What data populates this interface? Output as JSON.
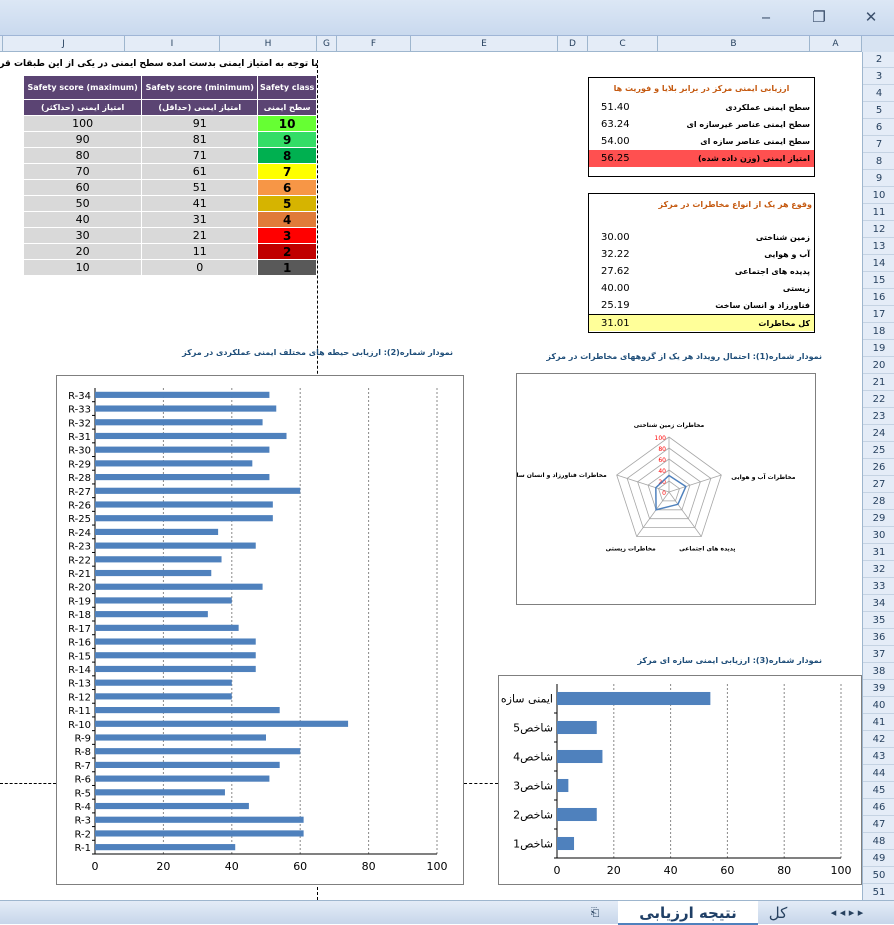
{
  "window": {
    "minimize": "‒",
    "restore": "❐",
    "close": "✕"
  },
  "columns": [
    "J",
    "I",
    "H",
    "G",
    "F",
    "E",
    "D",
    "C",
    "B",
    "A"
  ],
  "rows": [
    "2",
    "3",
    "4",
    "5",
    "6",
    "7",
    "8",
    "9",
    "10",
    "11",
    "12",
    "13",
    "14",
    "15",
    "16",
    "17",
    "18",
    "19",
    "20",
    "21",
    "22",
    "23",
    "24",
    "25",
    "26",
    "27",
    "28",
    "29",
    "30",
    "31",
    "32",
    "33",
    "34",
    "35",
    "36",
    "37",
    "38",
    "39",
    "40",
    "41",
    "42",
    "43",
    "44",
    "45",
    "46",
    "47",
    "48",
    "49",
    "50",
    "51"
  ],
  "top_text": "با توجه به امتیاز ایمنی بدست آمده سطح ایمنی در یکی از این طبقات قرار می گیرد",
  "safety_table": {
    "headers": [
      "Safety score (maximum)",
      "Safety score (minimum)",
      "Safety class"
    ],
    "subheaders": [
      "امتیاز ایمنی (حداکثر)",
      "امتیاز ایمنی (حداقل)",
      "سطح ایمنی"
    ],
    "rows": [
      {
        "max": "100",
        "min": "91",
        "cls": "10",
        "color": "#66ff33"
      },
      {
        "max": "90",
        "min": "81",
        "cls": "9",
        "color": "#33dd66"
      },
      {
        "max": "80",
        "min": "71",
        "cls": "8",
        "color": "#00b050"
      },
      {
        "max": "70",
        "min": "61",
        "cls": "7",
        "color": "#ffff00"
      },
      {
        "max": "60",
        "min": "51",
        "cls": "6",
        "color": "#f79646"
      },
      {
        "max": "50",
        "min": "41",
        "cls": "5",
        "color": "#d6b400"
      },
      {
        "max": "40",
        "min": "31",
        "cls": "4",
        "color": "#e07b39"
      },
      {
        "max": "30",
        "min": "21",
        "cls": "3",
        "color": "#ff0000"
      },
      {
        "max": "20",
        "min": "11",
        "cls": "2",
        "color": "#c00000"
      },
      {
        "max": "10",
        "min": "0",
        "cls": "1",
        "color": "#595959"
      }
    ]
  },
  "assessment": {
    "title": "ارزیابی ایمنی مرکز در برابر بلایا و فوریت ها",
    "rows": [
      {
        "label": "سطح ایمنی عملکردی",
        "value": "51.40"
      },
      {
        "label": "سطح ایمنی عناصر غیرسازه ای",
        "value": "63.24"
      },
      {
        "label": "سطح ایمنی عناصر سازه ای",
        "value": "54.00"
      }
    ],
    "total": {
      "label": "امتیاز ایمنی (وزن داده شده)",
      "value": "56.25"
    }
  },
  "hazards": {
    "title": "وقوع هر یک از انواع مخاطرات در مرکز",
    "rows": [
      {
        "label": "زمین شناختی",
        "value": "30.00"
      },
      {
        "label": "آب و هوایی",
        "value": "32.22"
      },
      {
        "label": "پدیده های اجتماعی",
        "value": "27.62"
      },
      {
        "label": "زیستی",
        "value": "40.00"
      },
      {
        "label": "فناورزاد و انسان ساخت",
        "value": "25.19"
      }
    ],
    "total": {
      "label": "کل مخاطرات",
      "value": "31.01"
    }
  },
  "captions": {
    "chart1": "نمودار شماره(1): احتمال رویداد هر یک از گروههای مخاطرات در مرکز",
    "chart2": "نمودار شماره(2): ارزیابی حیطه های مختلف ایمنی عملکردی در مرکز",
    "chart3": "نمودار شماره(3): ارزیابی ایمنی سازه ای مرکز"
  },
  "colors": {
    "bar": "#4f81bd",
    "radar_series": "#4f81bd",
    "radar_tick": "#ff0000",
    "caption": "#1f4e79"
  },
  "chart_data": [
    {
      "type": "bar",
      "orientation": "horizontal",
      "categories": [
        "R-1",
        "R-2",
        "R-3",
        "R-4",
        "R-5",
        "R-6",
        "R-7",
        "R-8",
        "R-9",
        "R-10",
        "R-11",
        "R-12",
        "R-13",
        "R-14",
        "R-15",
        "R-16",
        "R-17",
        "R-18",
        "R-19",
        "R-20",
        "R-21",
        "R-22",
        "R-23",
        "R-24",
        "R-25",
        "R-26",
        "R-27",
        "R-28",
        "R-29",
        "R-30",
        "R-31",
        "R-32",
        "R-33",
        "R-34"
      ],
      "values": [
        41,
        61,
        61,
        45,
        38,
        51,
        54,
        60,
        50,
        74,
        54,
        40,
        40,
        47,
        47,
        47,
        42,
        33,
        40,
        49,
        34,
        37,
        47,
        36,
        52,
        52,
        60,
        51,
        46,
        51,
        56,
        49,
        53,
        51
      ],
      "xlim": [
        0,
        100
      ],
      "xticks": [
        "0",
        "20",
        "40",
        "60",
        "80",
        "100"
      ],
      "grid": true
    },
    {
      "type": "radar",
      "categories": [
        "مخاطرات زمین شناختی",
        "مخاطرات آب و هوایی",
        "پدیده های اجتماعی",
        "مخاطرات زیستی",
        "مخاطرات فناورزاد و انسان ساخت"
      ],
      "values": [
        30.0,
        32.22,
        27.62,
        40.0,
        25.19
      ],
      "rlim": [
        0,
        100
      ],
      "rticks": [
        "0",
        "20",
        "40",
        "60",
        "80",
        "100"
      ]
    },
    {
      "type": "bar",
      "orientation": "horizontal",
      "categories": [
        "شاخص1",
        "شاخص2",
        "شاخص3",
        "شاخص4",
        "شاخص5",
        "ایمنی سازه ای"
      ],
      "values": [
        6,
        14,
        4,
        16,
        14,
        54
      ],
      "xlim": [
        0,
        100
      ],
      "xticks": [
        "0",
        "20",
        "40",
        "60",
        "80",
        "100"
      ],
      "grid": true
    }
  ],
  "sheet_tabs": {
    "active": "نتیجه ارزیابی",
    "other": "کل",
    "nav": "◂ ◂ ▸ ▸"
  }
}
